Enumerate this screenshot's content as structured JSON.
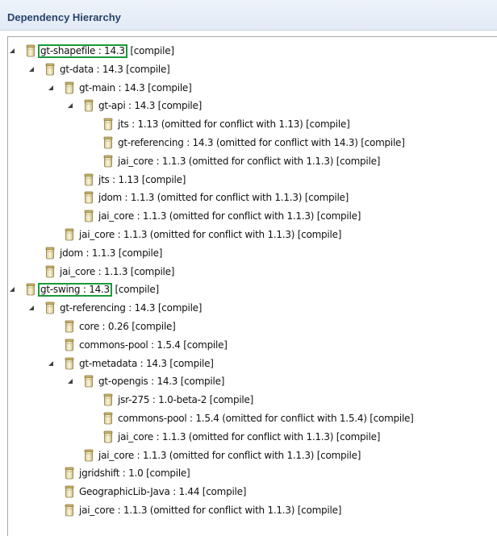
{
  "panel": {
    "title": "Dependency Hierarchy"
  },
  "tree": [
    {
      "level": 0,
      "expanded": true,
      "name": "gt-shapefile : 14.3",
      "rest": " [compile]",
      "highlight": true
    },
    {
      "level": 1,
      "expanded": true,
      "name": "gt-data : 14.3 [compile]",
      "rest": "",
      "highlight": false
    },
    {
      "level": 2,
      "expanded": true,
      "name": "gt-main : 14.3 [compile]",
      "rest": "",
      "highlight": false
    },
    {
      "level": 3,
      "expanded": true,
      "name": "gt-api : 14.3 [compile]",
      "rest": "",
      "highlight": false
    },
    {
      "level": 4,
      "expanded": null,
      "name": "jts : 1.13 (omitted for conflict with 1.13) [compile]",
      "rest": "",
      "highlight": false
    },
    {
      "level": 4,
      "expanded": null,
      "name": "gt-referencing : 14.3 (omitted for conflict with 14.3) [compile]",
      "rest": "",
      "highlight": false
    },
    {
      "level": 4,
      "expanded": null,
      "name": "jai_core : 1.1.3 (omitted for conflict with 1.1.3) [compile]",
      "rest": "",
      "highlight": false
    },
    {
      "level": 3,
      "expanded": null,
      "name": "jts : 1.13 [compile]",
      "rest": "",
      "highlight": false
    },
    {
      "level": 3,
      "expanded": null,
      "name": "jdom : 1.1.3 (omitted for conflict with 1.1.3) [compile]",
      "rest": "",
      "highlight": false
    },
    {
      "level": 3,
      "expanded": null,
      "name": "jai_core : 1.1.3 (omitted for conflict with 1.1.3) [compile]",
      "rest": "",
      "highlight": false
    },
    {
      "level": 2,
      "expanded": null,
      "name": "jai_core : 1.1.3 (omitted for conflict with 1.1.3) [compile]",
      "rest": "",
      "highlight": false
    },
    {
      "level": 1,
      "expanded": null,
      "name": "jdom : 1.1.3 [compile]",
      "rest": "",
      "highlight": false
    },
    {
      "level": 1,
      "expanded": null,
      "name": "jai_core : 1.1.3 [compile]",
      "rest": "",
      "highlight": false
    },
    {
      "level": 0,
      "expanded": true,
      "name": "gt-swing : 14.3",
      "rest": " [compile]",
      "highlight": true
    },
    {
      "level": 1,
      "expanded": true,
      "name": "gt-referencing : 14.3 [compile]",
      "rest": "",
      "highlight": false
    },
    {
      "level": 2,
      "expanded": null,
      "name": "core : 0.26 [compile]",
      "rest": "",
      "highlight": false
    },
    {
      "level": 2,
      "expanded": null,
      "name": "commons-pool : 1.5.4 [compile]",
      "rest": "",
      "highlight": false
    },
    {
      "level": 2,
      "expanded": true,
      "name": "gt-metadata : 14.3 [compile]",
      "rest": "",
      "highlight": false
    },
    {
      "level": 3,
      "expanded": true,
      "name": "gt-opengis : 14.3 [compile]",
      "rest": "",
      "highlight": false
    },
    {
      "level": 4,
      "expanded": null,
      "name": "jsr-275 : 1.0-beta-2 [compile]",
      "rest": "",
      "highlight": false
    },
    {
      "level": 4,
      "expanded": null,
      "name": "commons-pool : 1.5.4 (omitted for conflict with 1.5.4) [compile]",
      "rest": "",
      "highlight": false
    },
    {
      "level": 4,
      "expanded": null,
      "name": "jai_core : 1.1.3 (omitted for conflict with 1.1.3) [compile]",
      "rest": "",
      "highlight": false
    },
    {
      "level": 3,
      "expanded": null,
      "name": "jai_core : 1.1.3 (omitted for conflict with 1.1.3) [compile]",
      "rest": "",
      "highlight": false
    },
    {
      "level": 2,
      "expanded": null,
      "name": "jgridshift : 1.0 [compile]",
      "rest": "",
      "highlight": false
    },
    {
      "level": 2,
      "expanded": null,
      "name": "GeographicLib-Java : 1.44 [compile]",
      "rest": "",
      "highlight": false
    },
    {
      "level": 2,
      "expanded": null,
      "name": "jai_core : 1.1.3 (omitted for conflict with 1.1.3) [compile]",
      "rest": "",
      "highlight": false
    }
  ],
  "icons": {
    "expanded_twisty": "expanded-triangle-icon",
    "jar": "jar-icon"
  },
  "colors": {
    "highlight_border": "#1a9a3a",
    "title_text": "#27446a"
  }
}
